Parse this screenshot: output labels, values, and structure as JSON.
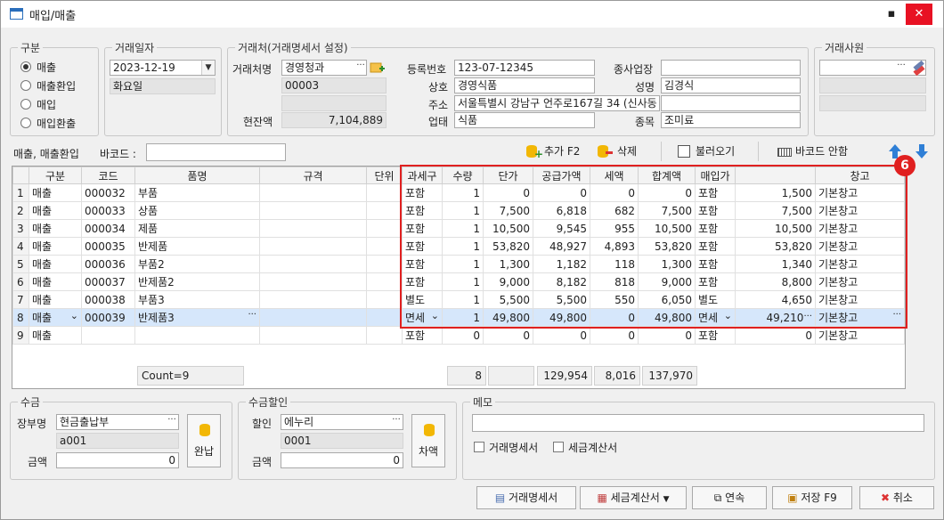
{
  "window": {
    "title": "매입/매출",
    "min_label": "▪",
    "close_label": "✕"
  },
  "gubun": {
    "legend": "구분",
    "options": [
      "매출",
      "매출환입",
      "매입",
      "매입환출"
    ],
    "selected": 0
  },
  "trade_date": {
    "legend": "거래일자",
    "date": "2023-12-19",
    "weekday": "화요일"
  },
  "client": {
    "legend": "거래처(거래명세서 설정)",
    "name_label": "거래처명",
    "name": "경영청과",
    "code": "00003",
    "blank": "",
    "balance_label": "현잔액",
    "balance": "7,104,889",
    "regno_label": "등록번호",
    "regno": "123-07-12345",
    "company_label": "상호",
    "company": "경영식품",
    "address_label": "주소",
    "address": "서울특별시 강남구 언주로167길 34 (신사동",
    "biztype_label": "업태",
    "biztype": "식품",
    "subsite_label": "종사업장",
    "subsite": "",
    "owner_label": "성명",
    "owner": "김경식",
    "extra": "",
    "item_label": "종목",
    "item": "조미료"
  },
  "employee": {
    "legend": "거래사원",
    "value": ""
  },
  "toolbar": {
    "mode_label": "매출, 매출환입",
    "barcode_label": "바코드 :",
    "barcode_value": "",
    "add_label": "추가 F2",
    "delete_label": "삭제",
    "load_label": "불러오기",
    "barcode_guide_label": "바코드 안함",
    "up_icon": "arrow-up-icon",
    "down_icon": "arrow-down-icon"
  },
  "grid": {
    "headers": [
      "",
      "구분",
      "코드",
      "품명",
      "규격",
      "단위",
      "과세구",
      "수량",
      "단가",
      "공급가액",
      "세액",
      "합계액",
      "매입가",
      "",
      "창고"
    ],
    "rows": [
      [
        "1",
        "매출",
        "000032",
        "부품",
        "",
        "",
        "포함",
        "1",
        "0",
        "0",
        "0",
        "0",
        "포함",
        "1,500",
        "기본창고"
      ],
      [
        "2",
        "매출",
        "000033",
        "상품",
        "",
        "",
        "포함",
        "1",
        "7,500",
        "6,818",
        "682",
        "7,500",
        "포함",
        "7,500",
        "기본창고"
      ],
      [
        "3",
        "매출",
        "000034",
        "제품",
        "",
        "",
        "포함",
        "1",
        "10,500",
        "9,545",
        "955",
        "10,500",
        "포함",
        "10,500",
        "기본창고"
      ],
      [
        "4",
        "매출",
        "000035",
        "반제품",
        "",
        "",
        "포함",
        "1",
        "53,820",
        "48,927",
        "4,893",
        "53,820",
        "포함",
        "53,820",
        "기본창고"
      ],
      [
        "5",
        "매출",
        "000036",
        "부품2",
        "",
        "",
        "포함",
        "1",
        "1,300",
        "1,182",
        "118",
        "1,300",
        "포함",
        "1,340",
        "기본창고"
      ],
      [
        "6",
        "매출",
        "000037",
        "반제품2",
        "",
        "",
        "포함",
        "1",
        "9,000",
        "8,182",
        "818",
        "9,000",
        "포함",
        "8,800",
        "기본창고"
      ],
      [
        "7",
        "매출",
        "000038",
        "부품3",
        "",
        "",
        "별도",
        "1",
        "5,500",
        "5,500",
        "550",
        "6,050",
        "별도",
        "4,650",
        "기본창고"
      ],
      [
        "8",
        "매출",
        "000039",
        "반제품3",
        "",
        "",
        "면세",
        "1",
        "49,800",
        "49,800",
        "0",
        "49,800",
        "면세",
        "49,210",
        "기본창고"
      ],
      [
        "9",
        "매출",
        "",
        "",
        "",
        "",
        "포함",
        "0",
        "0",
        "0",
        "0",
        "0",
        "포함",
        "0",
        "기본창고"
      ]
    ],
    "selected_row": 7,
    "footer": {
      "count": "Count=9",
      "qty": "8",
      "blank": "",
      "supply": "129,954",
      "tax": "8,016",
      "total": "137,970"
    }
  },
  "annotation": {
    "badge": "6",
    "color": "#e02020"
  },
  "payment": {
    "legend": "수금",
    "account_label": "장부명",
    "account": "현금출납부",
    "code": "a001",
    "amount_label": "금액",
    "amount": "0",
    "full_label": "완납"
  },
  "discount": {
    "legend": "수금할인",
    "label": "할인",
    "value": "에누리",
    "code": "0001",
    "amount_label": "금액",
    "amount": "0",
    "diff_label": "차액"
  },
  "memo": {
    "legend": "메모",
    "value": "",
    "statement_label": "거래명세서",
    "invoice_label": "세금계산서"
  },
  "bottom": {
    "statement_btn": "거래명세서",
    "invoice_btn": "세금계산서",
    "continue_btn": "연속",
    "save_btn": "저장 F9",
    "cancel_btn": "취소"
  }
}
